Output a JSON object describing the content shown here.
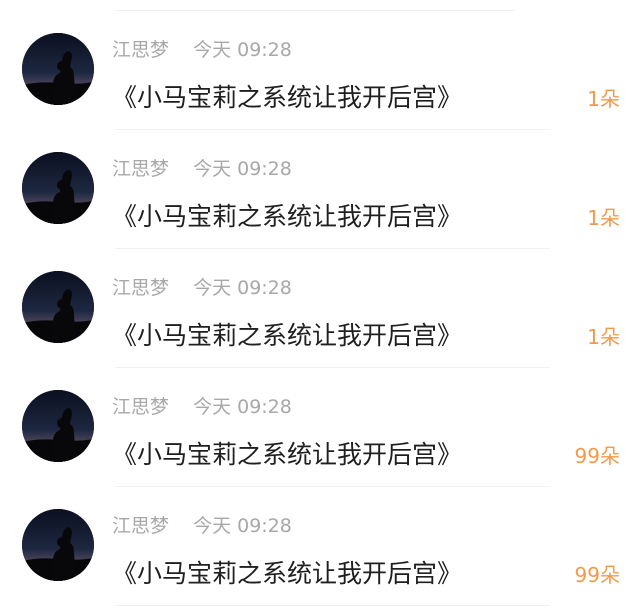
{
  "messages": [
    {
      "name": "江思梦",
      "time": "今天 09:28",
      "title": "《小马宝莉之系统让我开后宫》",
      "gift": "1朵"
    },
    {
      "name": "江思梦",
      "time": "今天 09:28",
      "title": "《小马宝莉之系统让我开后宫》",
      "gift": "1朵"
    },
    {
      "name": "江思梦",
      "time": "今天 09:28",
      "title": "《小马宝莉之系统让我开后宫》",
      "gift": "1朵"
    },
    {
      "name": "江思梦",
      "time": "今天 09:28",
      "title": "《小马宝莉之系统让我开后宫》",
      "gift": "99朵"
    },
    {
      "name": "江思梦",
      "time": "今天 09:28",
      "title": "《小马宝莉之系统让我开后宫》",
      "gift": "99朵"
    }
  ],
  "colors": {
    "name": "#a8a8a8",
    "title": "#1f1f1f",
    "gift": "#f29a4a",
    "divider": "#f1f1f1"
  },
  "icons": {
    "avatar": "silhouette-avatar-icon"
  }
}
